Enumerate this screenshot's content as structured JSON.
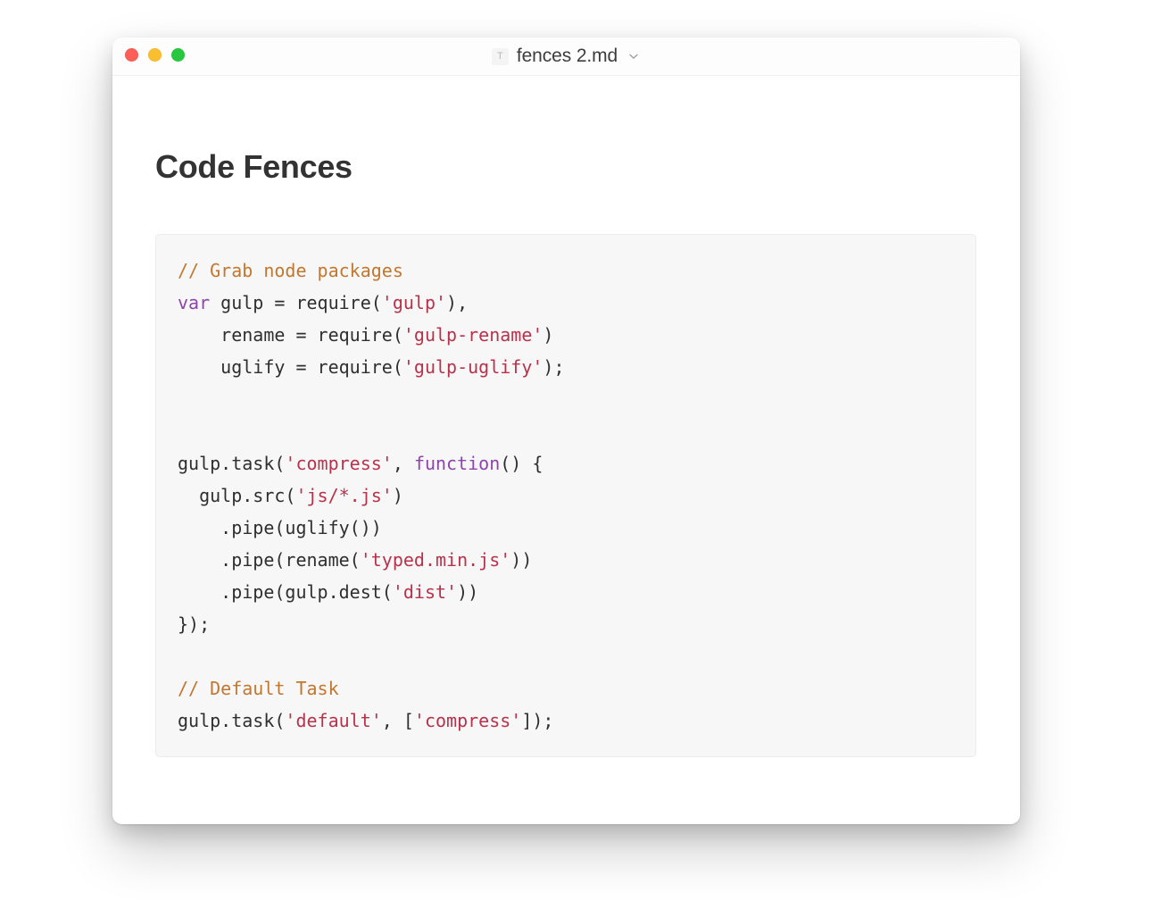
{
  "window": {
    "traffic_lights": [
      {
        "name": "close",
        "color": "#fb5f57"
      },
      {
        "name": "minimize",
        "color": "#fbbe2f"
      },
      {
        "name": "maximize",
        "color": "#27c840"
      }
    ],
    "title": "fences 2.md",
    "doc_icon_label": "T",
    "doc_icon_name": "text-document-icon",
    "chevron_icon_name": "chevron-down-icon"
  },
  "document": {
    "heading": "Code Fences",
    "code_block": {
      "language": "javascript",
      "background": "#f7f7f7",
      "border_color": "#ececec",
      "plain_text": "// Grab node packages\nvar gulp = require('gulp'),\n    rename = require('gulp-rename')\n    uglify = require('gulp-uglify');\n\n\ngulp.task('compress', function() {\n  gulp.src('js/*.js')\n    .pipe(uglify())\n    .pipe(rename('typed.min.js'))\n    .pipe(gulp.dest('dist'))\n});\n\n// Default Task\ngulp.task('default', ['compress']);",
      "lines": [
        [
          {
            "t": "comment",
            "s": "// Grab node packages"
          }
        ],
        [
          {
            "t": "keyword",
            "s": "var"
          },
          {
            "t": "plain",
            "s": " gulp = require("
          },
          {
            "t": "string",
            "s": "'gulp'"
          },
          {
            "t": "plain",
            "s": "),"
          }
        ],
        [
          {
            "t": "plain",
            "s": "    rename = require("
          },
          {
            "t": "string",
            "s": "'gulp-rename'"
          },
          {
            "t": "plain",
            "s": ")"
          }
        ],
        [
          {
            "t": "plain",
            "s": "    uglify = require("
          },
          {
            "t": "string",
            "s": "'gulp-uglify'"
          },
          {
            "t": "plain",
            "s": ");"
          }
        ],
        [
          {
            "t": "plain",
            "s": ""
          }
        ],
        [
          {
            "t": "plain",
            "s": ""
          }
        ],
        [
          {
            "t": "plain",
            "s": "gulp.task("
          },
          {
            "t": "string",
            "s": "'compress'"
          },
          {
            "t": "plain",
            "s": ", "
          },
          {
            "t": "keyword",
            "s": "function"
          },
          {
            "t": "plain",
            "s": "() {"
          }
        ],
        [
          {
            "t": "plain",
            "s": "  gulp.src("
          },
          {
            "t": "string",
            "s": "'js/*.js'"
          },
          {
            "t": "plain",
            "s": ")"
          }
        ],
        [
          {
            "t": "plain",
            "s": "    .pipe(uglify())"
          }
        ],
        [
          {
            "t": "plain",
            "s": "    .pipe(rename("
          },
          {
            "t": "string",
            "s": "'typed.min.js'"
          },
          {
            "t": "plain",
            "s": "))"
          }
        ],
        [
          {
            "t": "plain",
            "s": "    .pipe(gulp.dest("
          },
          {
            "t": "string",
            "s": "'dist'"
          },
          {
            "t": "plain",
            "s": "))"
          }
        ],
        [
          {
            "t": "plain",
            "s": "});"
          }
        ],
        [
          {
            "t": "plain",
            "s": ""
          }
        ],
        [
          {
            "t": "comment",
            "s": "// Default Task"
          }
        ],
        [
          {
            "t": "plain",
            "s": "gulp.task("
          },
          {
            "t": "string",
            "s": "'default'"
          },
          {
            "t": "plain",
            "s": ", ["
          },
          {
            "t": "string",
            "s": "'compress'"
          },
          {
            "t": "plain",
            "s": "]);"
          }
        ]
      ]
    }
  },
  "colors": {
    "comment": "#c2772f",
    "keyword": "#8e44ad",
    "string": "#b8324c",
    "plain": "#2f2f2f",
    "heading": "#333333",
    "title": "#3d3d3d",
    "page_background": "#ffffff"
  }
}
